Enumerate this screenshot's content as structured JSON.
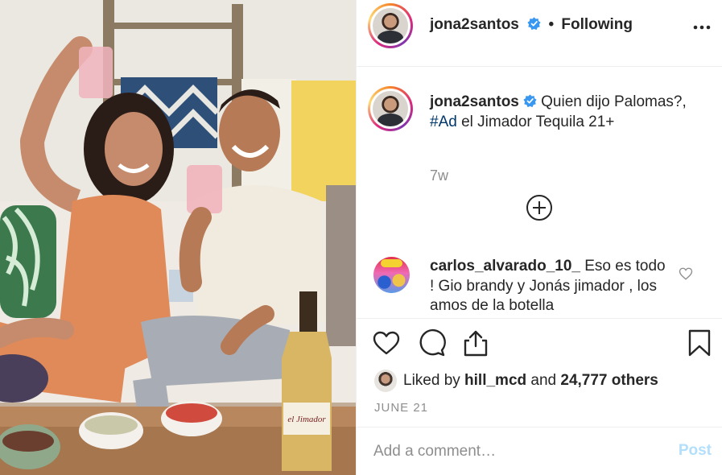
{
  "header": {
    "username": "jona2santos",
    "separator": "•",
    "follow_status": "Following"
  },
  "caption": {
    "username": "jona2santos",
    "text_before": "Quien dijo Palomas?, ",
    "hashtag": "#Ad",
    "text_after": " el Jimador Tequila 21+",
    "time_ago": "7w"
  },
  "comment": {
    "username": "carlos_alvarado_10_",
    "text": "Eso es todo ! Gio brandy y Jonás jimador , los amos de la botella"
  },
  "likes": {
    "prefix": "Liked by ",
    "first_user": "hill_mcd",
    "middle": " and ",
    "count_text": "24,777 others"
  },
  "date": "JUNE 21",
  "add_comment": {
    "placeholder": "Add a comment…",
    "post_label": "Post"
  },
  "photo": {
    "bottle_label": "el Jimador"
  },
  "colors": {
    "verified_blue": "#3897f0",
    "hashtag": "#00376b",
    "muted": "#8e8e8e",
    "post_disabled": "#b2dffc"
  },
  "icons": [
    "verified-badge-icon",
    "more-options-icon",
    "load-more-icon",
    "heart-icon",
    "comment-icon",
    "share-icon",
    "bookmark-icon"
  ]
}
